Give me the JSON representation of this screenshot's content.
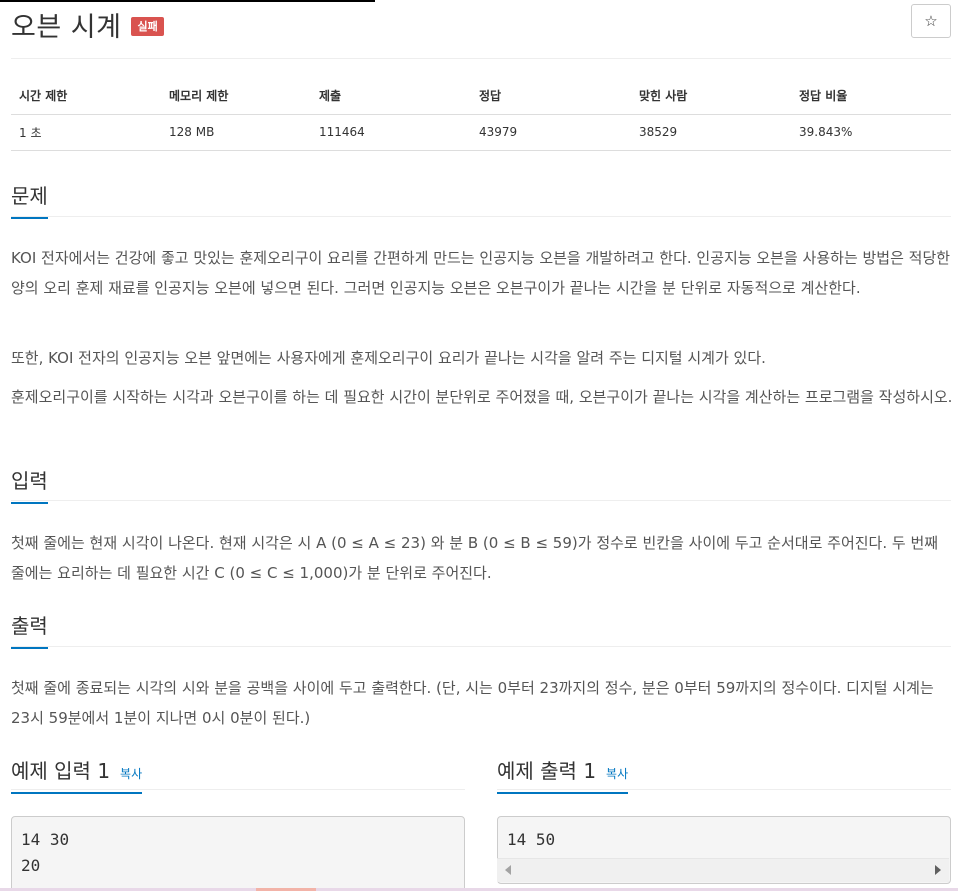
{
  "problem": {
    "title": "오븐 시계",
    "result_badge": "실패",
    "star_icon": "☆"
  },
  "info_table": {
    "headers": [
      "시간 제한",
      "메모리 제한",
      "제출",
      "정답",
      "맞힌 사람",
      "정답 비율"
    ],
    "values": [
      "1 초",
      "128 MB",
      "111464",
      "43979",
      "38529",
      "39.843%"
    ]
  },
  "sections": {
    "description": {
      "heading": "문제",
      "paragraphs": [
        "KOI 전자에서는 건강에 좋고 맛있는 훈제오리구이 요리를 간편하게 만드는 인공지능 오븐을 개발하려고 한다. 인공지능 오븐을 사용하는 방법은 적당한 양의 오리 훈제 재료를 인공지능 오븐에 넣으면 된다. 그러면 인공지능 오븐은 오븐구이가 끝나는 시간을 분 단위로 자동적으로 계산한다.",
        "또한, KOI 전자의 인공지능 오븐 앞면에는 사용자에게 훈제오리구이 요리가 끝나는 시각을 알려 주는 디지털 시계가 있다.",
        "훈제오리구이를 시작하는 시각과 오븐구이를 하는 데 필요한 시간이 분단위로 주어졌을 때, 오븐구이가 끝나는 시각을 계산하는 프로그램을 작성하시오."
      ]
    },
    "input": {
      "heading": "입력",
      "paragraph": "첫째 줄에는 현재 시각이 나온다. 현재 시각은 시 A (0 ≤ A ≤ 23) 와 분 B (0 ≤ B ≤ 59)가 정수로 빈칸을 사이에 두고 순서대로 주어진다. 두 번째 줄에는 요리하는 데 필요한 시간 C (0 ≤ C ≤ 1,000)가 분 단위로 주어진다."
    },
    "output": {
      "heading": "출력",
      "paragraph": "첫째 줄에 종료되는 시각의 시와 분을 공백을 사이에 두고 출력한다. (단, 시는 0부터 23까지의 정수, 분은 0부터 59까지의 정수이다. 디지털 시계는 23시 59분에서 1분이 지나면 0시 0분이 된다.)"
    }
  },
  "samples": {
    "input_title": "예제 입력 1",
    "input_copy": "복사",
    "input_value": "14 30\n20",
    "output_title": "예제 출력 1",
    "output_copy": "복사",
    "output_value": "14 50"
  },
  "colors": {
    "accent": "#0076c0",
    "badge": "#d9534f",
    "sample_bg": "#f5f5f5"
  }
}
